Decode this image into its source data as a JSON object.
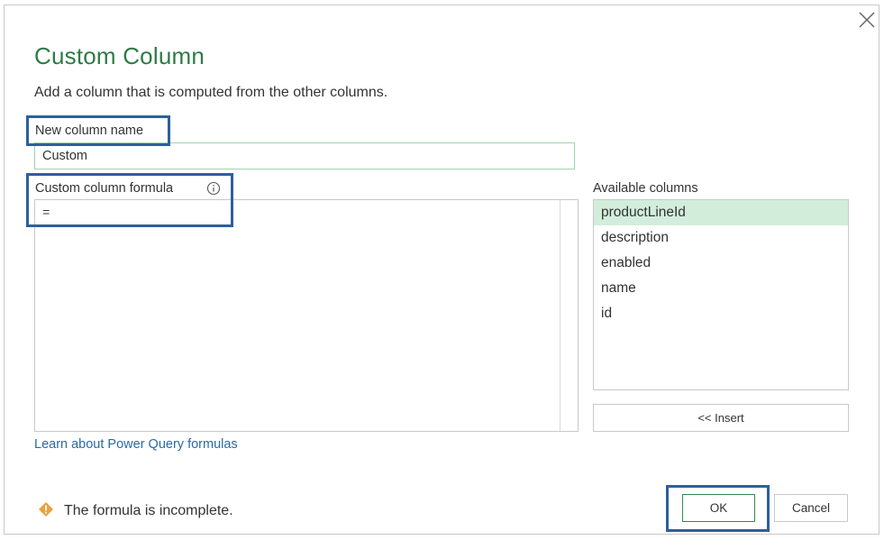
{
  "dialog": {
    "title": "Custom Column",
    "subtitle": "Add a column that is computed from the other columns."
  },
  "column_name": {
    "label": "New column name",
    "value": "Custom"
  },
  "formula": {
    "label": "Custom column formula",
    "value": "="
  },
  "available_columns": {
    "label": "Available columns",
    "items": [
      "productLineId",
      "description",
      "enabled",
      "name",
      "id"
    ],
    "selected": "productLineId",
    "insert_label": "<< Insert"
  },
  "learn_link": "Learn about Power Query formulas",
  "status": {
    "icon": "warning-icon",
    "message": "The formula is incomplete."
  },
  "buttons": {
    "ok": "OK",
    "cancel": "Cancel"
  },
  "colors": {
    "title": "#2f7a47",
    "selected_row": "#d2eedb",
    "link": "#2a6aa8",
    "highlight": "#2e5f9e",
    "warning": "#e8a33d"
  }
}
